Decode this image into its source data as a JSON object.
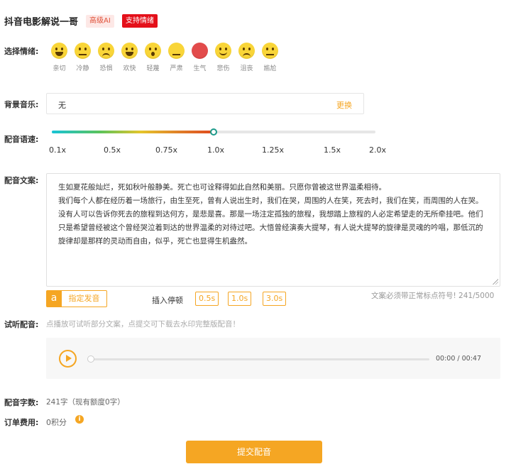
{
  "header": {
    "title": "抖音电影解说一哥",
    "badge_ai": "高级AI",
    "badge_emotion": "支持情绪"
  },
  "emotion": {
    "label": "选择情绪:",
    "items": [
      {
        "label": "亲切",
        "icon": "grin-face-icon"
      },
      {
        "label": "冷静",
        "icon": "neutral-face-icon"
      },
      {
        "label": "恐惧",
        "icon": "fearful-face-icon"
      },
      {
        "label": "欢快",
        "icon": "laughing-face-icon"
      },
      {
        "label": "轻蔑",
        "icon": "surprised-face-icon"
      },
      {
        "label": "严肃",
        "icon": "serious-face-icon"
      },
      {
        "label": "生气",
        "icon": "angry-face-icon"
      },
      {
        "label": "悲伤",
        "icon": "sad-face-icon"
      },
      {
        "label": "沮丧",
        "icon": "frowning-face-icon"
      },
      {
        "label": "尴尬",
        "icon": "awkward-face-icon"
      }
    ]
  },
  "music": {
    "label": "背景音乐:",
    "value": "无",
    "change_label": "更换"
  },
  "speed": {
    "label": "配音语速:",
    "ticks": [
      "0.1x",
      "0.5x",
      "0.75x",
      "1.0x",
      "1.25x",
      "1.5x",
      "2.0x"
    ],
    "selected": "1.0x"
  },
  "text": {
    "label": "配音文案:",
    "paragraphs": [
      "生如夏花般灿烂，死如秋叶般静美。死亡也可诠释得如此自然和美丽。只愿你曾被这世界温柔相待。",
      "我们每个人都在经历着一场旅行，由生至死，曾有人说出生时，我们在哭，周围的人在笑，死去时，我们在笑，而周围的人在哭。没有人可以告诉你死去的旅程到达何方，是悲是喜。那是一场注定孤独的旅程，我想踏上旅程的人必定希望走的无所牵挂吧。他们只是希望曾经被这个曾经哭泣着到达的世界温柔的对待过吧。大悟曾经演奏大提琴，有人说大提琴的旋律是灵魂的吟唱，那低沉的旋律却是那样的灵动而自由，似乎，死亡也显得生机盎然。"
    ]
  },
  "tools": {
    "voice_icon": "a",
    "voice_button": "指定发音",
    "pause_label": "插入停顿",
    "pause_options": [
      "0.5s",
      "1.0s",
      "3.0s"
    ],
    "hint": "文案必须带正常标点符号! 241/5000"
  },
  "preview": {
    "label": "试听配音:",
    "hint": "点播放可试听部分文案，点提交可下载去水印完整版配音！",
    "time": "00:00 / 00:47",
    "progress": 0
  },
  "count": {
    "label": "配音字数:",
    "value": "241字（现有额度0字）"
  },
  "fee": {
    "label": "订单费用:",
    "value": "0积分"
  },
  "submit_label": "提交配音",
  "colors": {
    "accent": "#f5a623",
    "badge_red": "#e4101a"
  }
}
